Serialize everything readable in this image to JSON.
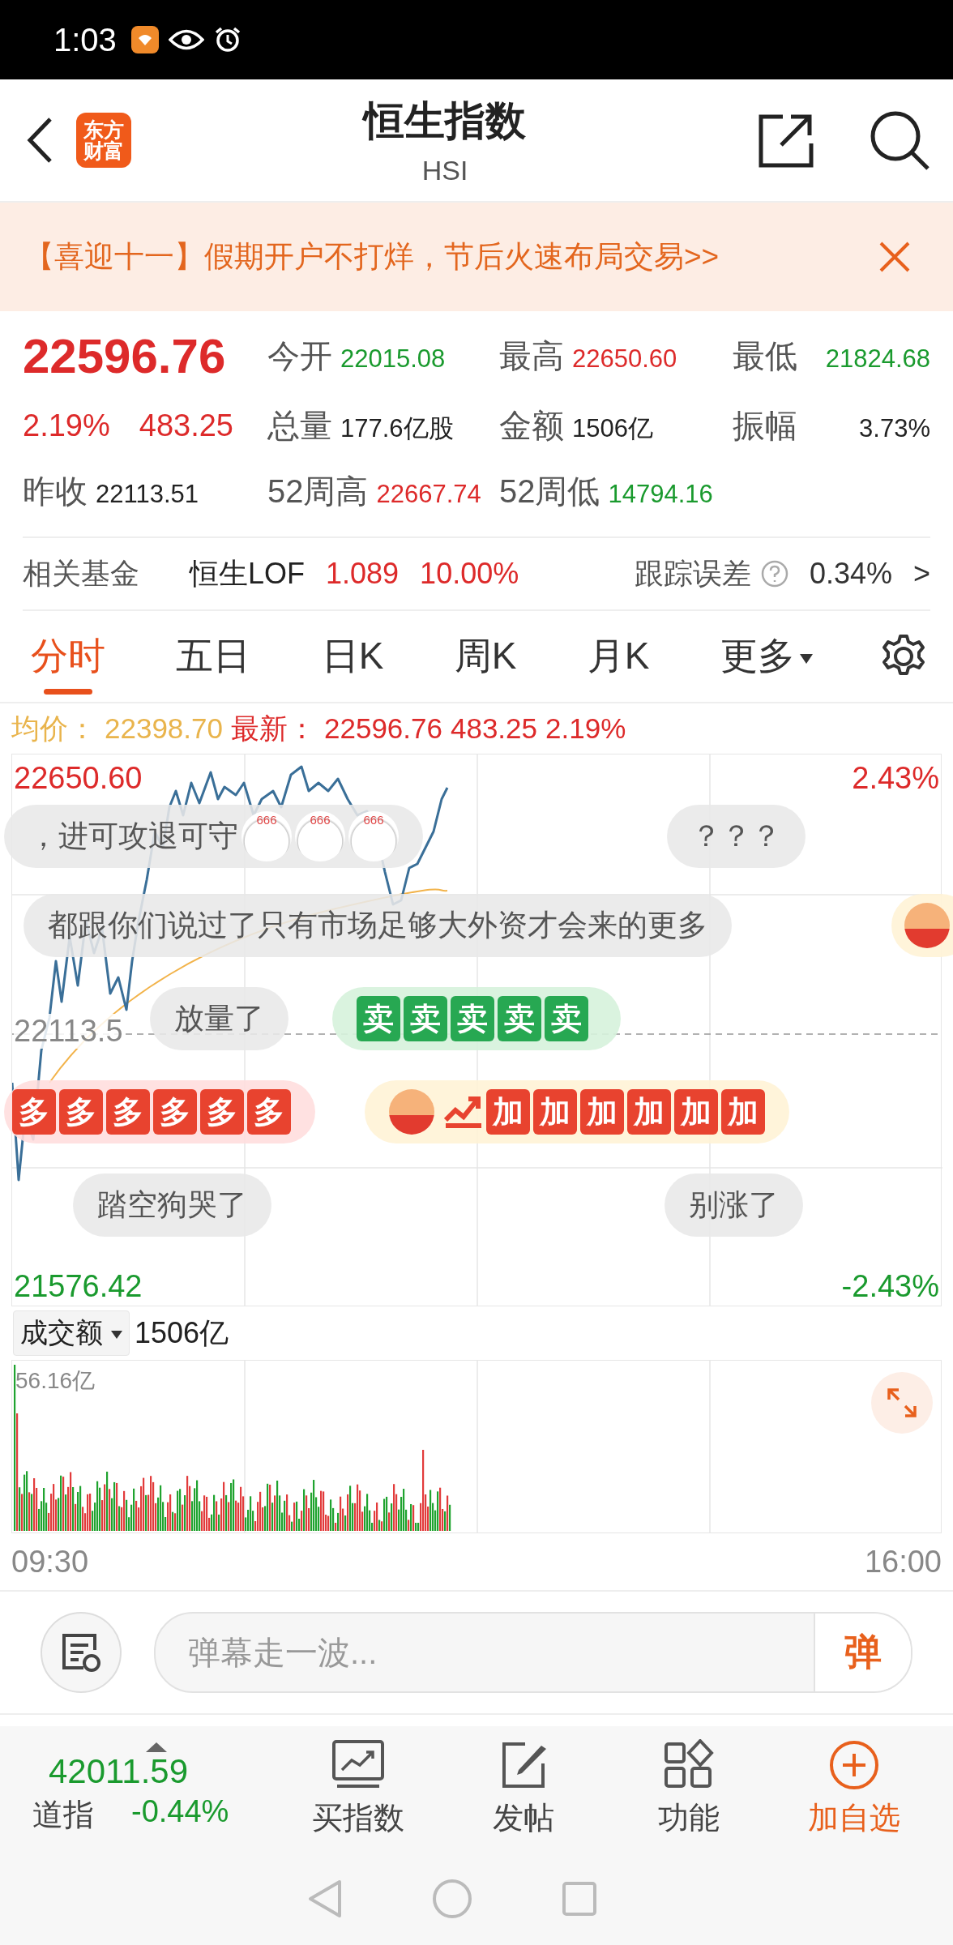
{
  "status_bar": {
    "time": "1:03"
  },
  "header": {
    "logo": "东方财富",
    "title": "恒生指数",
    "subtitle": "HSI"
  },
  "banner": {
    "text": "【喜迎十一】假期开户不打烊，节后火速布局交易>>"
  },
  "quote": {
    "price": "22596.76",
    "change_pct": "2.19%",
    "change": "483.25",
    "prev_label": "昨收",
    "prev_value": "22113.51",
    "stats": [
      {
        "label": "今开",
        "value": "22015.08",
        "color": "#1a9a2e"
      },
      {
        "label": "最高",
        "value": "22650.60",
        "color": "#dd2a2a"
      },
      {
        "label": "最低",
        "value": "21824.68",
        "color": "#1a9a2e"
      },
      {
        "label": "总量",
        "value": "177.6亿股",
        "color": "#222222"
      },
      {
        "label": "金额",
        "value": "1506亿",
        "color": "#222222"
      },
      {
        "label": "振幅",
        "value": "3.73%",
        "color": "#222222"
      },
      {
        "label": "52周高",
        "value": "22667.74",
        "color": "#dd2a2a"
      },
      {
        "label": "52周低",
        "value": "14794.16",
        "color": "#1a9a2e"
      }
    ]
  },
  "fund": {
    "label": "相关基金",
    "name": "恒生LOF",
    "price": "1.089",
    "pct": "10.00%",
    "tracking_label": "跟踪误差",
    "tracking_value": "0.34%",
    "arrow": ">"
  },
  "tabs": [
    {
      "label": "分时",
      "selected": true,
      "kind": "plain"
    },
    {
      "label": "五日",
      "selected": false,
      "kind": "plain"
    },
    {
      "label": "日K",
      "selected": false,
      "kind": "plain"
    },
    {
      "label": "周K",
      "selected": false,
      "kind": "plain"
    },
    {
      "label": "月K",
      "selected": false,
      "kind": "plain"
    },
    {
      "label": "更多",
      "selected": false,
      "kind": "dropdown"
    }
  ],
  "info": {
    "avg_label": "均价：",
    "avg": "22398.70",
    "last_label": "最新：",
    "last": "22596.76",
    "change": "483.25",
    "pct": "2.19%"
  },
  "chart": {
    "high": "22650.60",
    "high_pct": "2.43%",
    "prev": "22113.5",
    "low": "21576.42",
    "low_pct": "-2.43%"
  },
  "danmaku": [
    {
      "kind": "text",
      "text": "，进可攻退可守",
      "stickers": [
        "666",
        "666",
        "666"
      ]
    },
    {
      "kind": "text",
      "text": "？？？"
    },
    {
      "kind": "text",
      "text": "都跟你们说过了只有市场足够大外资才会来的更多"
    },
    {
      "kind": "mascot"
    },
    {
      "kind": "text",
      "text": "放量了"
    },
    {
      "kind": "tiles",
      "color": "#27a852",
      "tiles": [
        "卖",
        "卖",
        "卖",
        "卖",
        "卖"
      ]
    },
    {
      "kind": "tiles",
      "color": "#e8432f",
      "tiles": [
        "多",
        "多",
        "多",
        "多",
        "多",
        "多"
      ]
    },
    {
      "kind": "tiles",
      "color": "#e8432f",
      "lead": [
        {
          "kind": "mascot"
        },
        {
          "kind": "trend"
        }
      ],
      "tiles": [
        "加",
        "加",
        "加",
        "加",
        "加",
        "加"
      ]
    },
    {
      "kind": "text",
      "text": "踏空狗哭了"
    },
    {
      "kind": "text",
      "text": "别涨了"
    }
  ],
  "volume": {
    "metric": "成交额",
    "total": "1506亿",
    "max": "56.16亿",
    "start": "09:30",
    "end": "16:00"
  },
  "comment": {
    "placeholder": "弹幕走一波...",
    "send": "弹"
  },
  "bottom": {
    "index": {
      "value": "42011.59",
      "name": "道指",
      "pct": "-0.44%",
      "color": "#1a9a2e"
    },
    "actions": [
      {
        "label": "买指数",
        "kind": "chart"
      },
      {
        "label": "发帖",
        "kind": "edit"
      },
      {
        "label": "功能",
        "kind": "grid"
      },
      {
        "label": "加自选",
        "kind": "add"
      }
    ]
  }
}
